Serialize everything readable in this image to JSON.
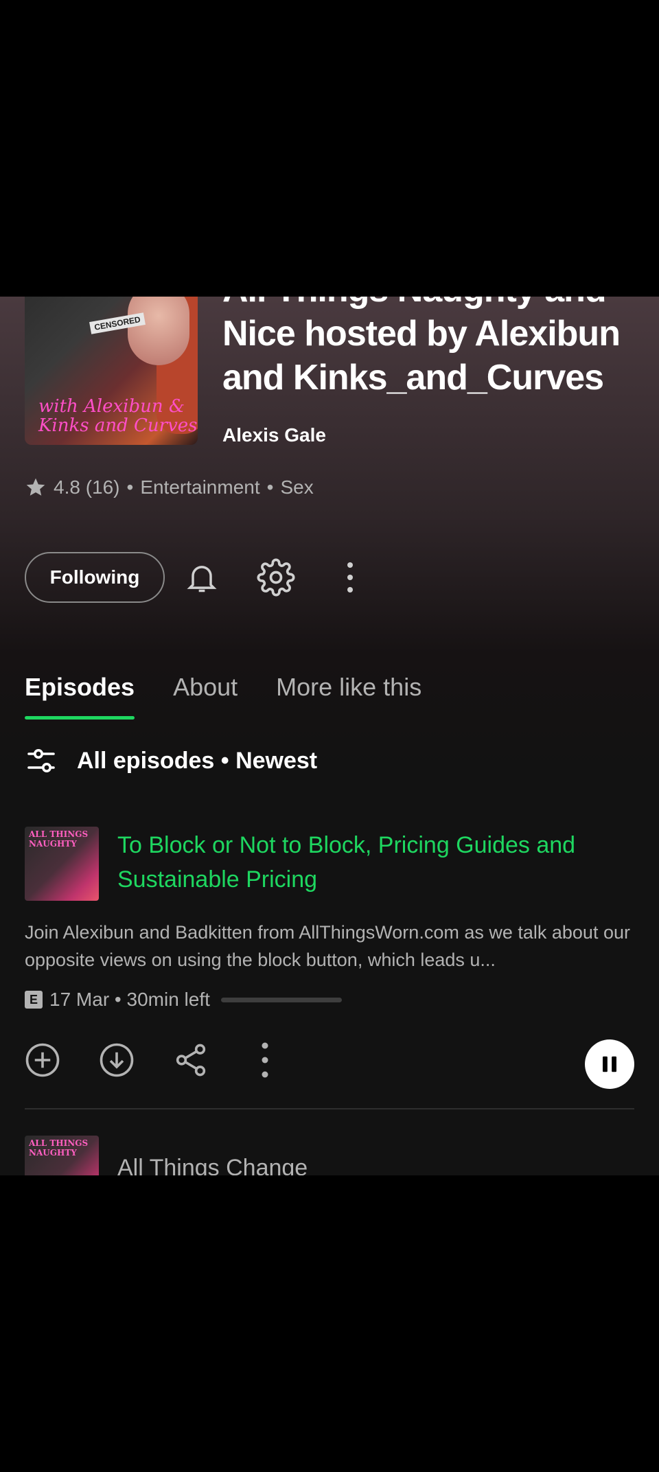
{
  "podcast": {
    "title": "All Things Naughty and Nice hosted by Alexibun and Kinks_and_Curves",
    "author": "Alexis Gale",
    "cover_text": "with Alexibun & Kinks and Curves",
    "cover_badge": "CENSORED",
    "rating": "4.8 (16)",
    "category_1": "Entertainment",
    "category_2": "Sex",
    "separator": "•"
  },
  "actions": {
    "follow_label": "Following",
    "bell_icon": "bell-icon",
    "settings_icon": "gear-icon",
    "more_icon": "more-vertical-icon"
  },
  "tabs": [
    {
      "label": "Episodes",
      "active": true
    },
    {
      "label": "About",
      "active": false
    },
    {
      "label": "More like this",
      "active": false
    }
  ],
  "filter": {
    "label": "All episodes • Newest",
    "icon": "sliders-icon"
  },
  "episodes": [
    {
      "thumb_text": "ALL THINGS NAUGHTY",
      "title": "To Block or Not to Block, Pricing Guides and Sustainable Pricing",
      "description": "Join Alexibun and Badkitten from AllThingsWorn.com as we talk about our opposite views on using the block button, which leads u...",
      "explicit_badge": "E",
      "info": "17 Mar • 30min left",
      "progress": 0.0,
      "actions": [
        "add-circle-icon",
        "download-icon",
        "share-icon",
        "more-vertical-icon"
      ],
      "play_state": "pause-icon"
    },
    {
      "thumb_text": "ALL THINGS NAUGHTY",
      "title": "All Things Change"
    }
  ],
  "colors": {
    "accent": "#1ed760",
    "background": "#121212",
    "text_secondary": "#b3b3b3"
  }
}
